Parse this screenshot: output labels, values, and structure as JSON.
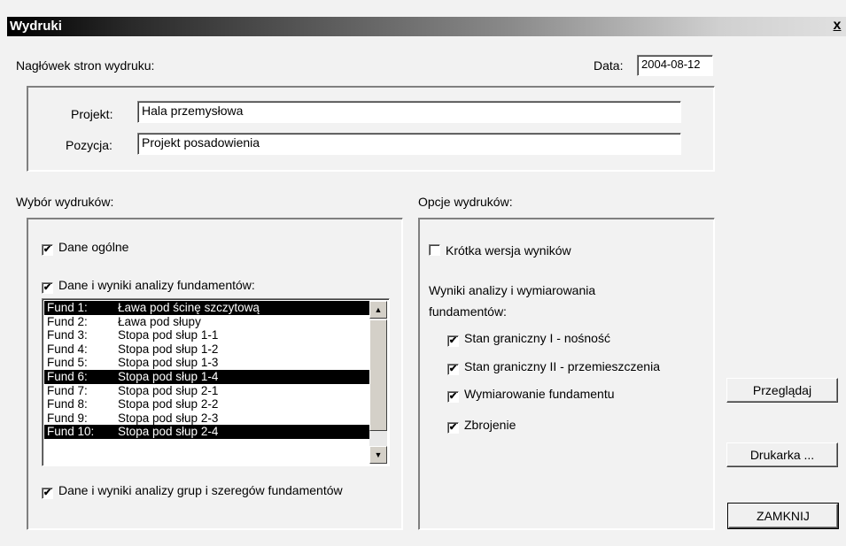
{
  "window": {
    "title": "Wydruki",
    "close_glyph": "x"
  },
  "header": {
    "section_label": "Nagłówek stron wydruku:",
    "date_label": "Data:",
    "date_value": "2004-08-12",
    "project_label": "Projekt:",
    "project_value": "Hala przemysłowa",
    "position_label": "Pozycja:",
    "position_value": "Projekt posadowienia"
  },
  "selection": {
    "section_label": "Wybór wydruków:",
    "general_data": {
      "label": "Dane ogólne",
      "checked": true
    },
    "foundations": {
      "label": "Dane i wyniki analizy fundamentów:",
      "checked": true
    },
    "groups": {
      "label": "Dane i wyniki analizy grup i szeregów fundamentów",
      "checked": true
    },
    "foundation_list": [
      {
        "id": "Fund 1:",
        "name": "Ława pod ścinę szczytową",
        "selected": true
      },
      {
        "id": "Fund 2:",
        "name": "Ława pod słupy",
        "selected": false
      },
      {
        "id": "Fund 3:",
        "name": "Stopa pod słup 1-1",
        "selected": false
      },
      {
        "id": "Fund 4:",
        "name": "Stopa pod słup 1-2",
        "selected": false
      },
      {
        "id": "Fund 5:",
        "name": "Stopa pod słup 1-3",
        "selected": false
      },
      {
        "id": "Fund 6:",
        "name": "Stopa pod słup 1-4",
        "selected": true
      },
      {
        "id": "Fund 7:",
        "name": "Stopa pod słup 2-1",
        "selected": false
      },
      {
        "id": "Fund 8:",
        "name": "Stopa pod słup 2-2",
        "selected": false
      },
      {
        "id": "Fund 9:",
        "name": "Stopa pod słup 2-3",
        "selected": false
      },
      {
        "id": "Fund 10:",
        "name": "Stopa pod słup 2-4",
        "selected": true
      }
    ],
    "scroll_up_icon": "triangle-up",
    "scroll_down_icon": "triangle-down"
  },
  "options": {
    "section_label": "Opcje wydruków:",
    "short_version": {
      "label": "Krótka wersja wyników",
      "checked": false
    },
    "results_label_line1": "Wyniki analizy i wymiarowania",
    "results_label_line2": "fundamentów:",
    "limit_state_1": {
      "label": "Stan graniczny I - nośność",
      "checked": true
    },
    "limit_state_2": {
      "label": "Stan graniczny II - przemieszczenia",
      "checked": true
    },
    "dimensioning": {
      "label": "Wymiarowanie fundamentu",
      "checked": true
    },
    "reinforcement": {
      "label": "Zbrojenie",
      "checked": true
    }
  },
  "buttons": {
    "preview": "Przeglądaj",
    "printer": "Drukarka ...",
    "close": "ZAMKNIJ"
  },
  "check_glyph": "✔"
}
